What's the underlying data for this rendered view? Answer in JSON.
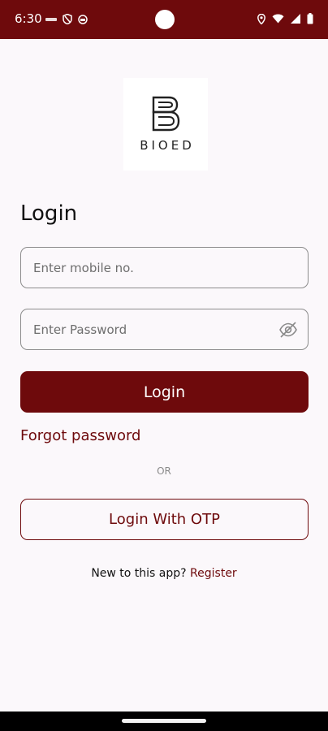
{
  "status_bar": {
    "time": "6:30",
    "background_color": "#6e0a0c",
    "left_icons": [
      "data-icon",
      "shield-icon",
      "sim-icon"
    ],
    "right_icons": [
      "location-icon",
      "wifi-icon",
      "signal-icon",
      "battery-icon"
    ]
  },
  "brand": {
    "logo_text": "BIOED",
    "accent_color": "#6e0a0c"
  },
  "login": {
    "title": "Login",
    "mobile_placeholder": "Enter mobile no.",
    "password_placeholder": "Enter Password",
    "login_button": "Login",
    "forgot_password": "Forgot password",
    "or_text": "OR",
    "otp_button": "Login With OTP",
    "register_prompt": "New to this app?",
    "register_link": "Register"
  }
}
